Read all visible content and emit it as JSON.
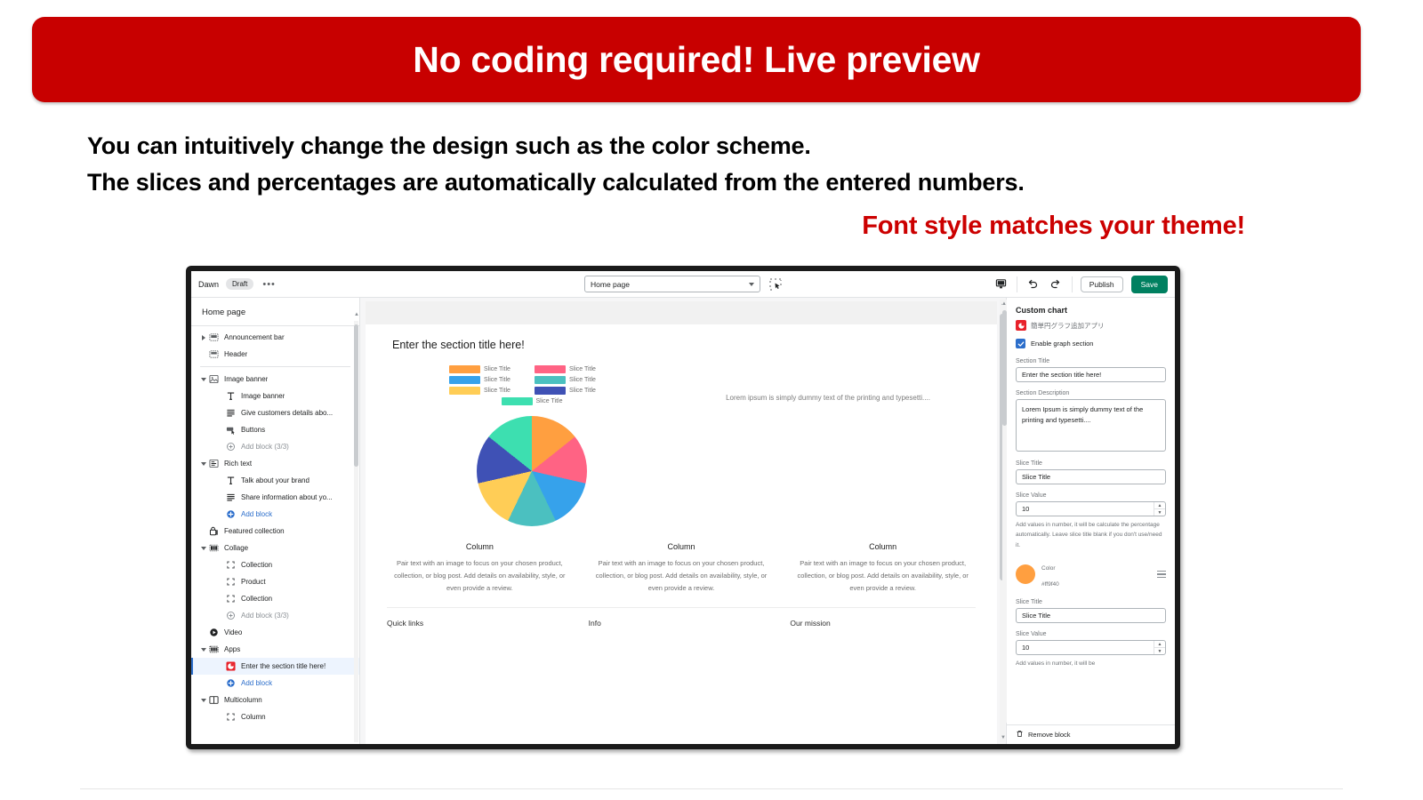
{
  "banner": {
    "text": "No coding required! Live preview",
    "bg": "#c80000",
    "fg": "#ffffff"
  },
  "headlines": {
    "line1": "You can intuitively change the design such as the color scheme.",
    "line2": "The slices and percentages are automatically calculated from the entered numbers.",
    "line3": "Font style matches your theme!",
    "line3_color": "#cc0000"
  },
  "editor": {
    "toolbar": {
      "theme_name": "Dawn",
      "status_badge": "Draft",
      "more_dots": "•••",
      "page_selector_value": "Home page",
      "publish_label": "Publish",
      "save_label": "Save",
      "save_color": "#008060"
    },
    "sidebar": {
      "title": "Home page",
      "items": [
        {
          "label": "Announcement bar",
          "icon": "section-icon",
          "twisty": "right",
          "depth": 0,
          "style": "normal"
        },
        {
          "label": "Header",
          "icon": "header-icon",
          "twisty": "none",
          "depth": 0,
          "style": "normal"
        },
        {
          "label": "Image banner",
          "icon": "image-icon",
          "twisty": "down",
          "depth": 0,
          "style": "normal"
        },
        {
          "label": "Image banner",
          "icon": "text-icon",
          "twisty": "none",
          "depth": 1,
          "style": "normal"
        },
        {
          "label": "Give customers details abo...",
          "icon": "paragraph-icon",
          "twisty": "none",
          "depth": 1,
          "style": "normal"
        },
        {
          "label": "Buttons",
          "icon": "button-icon",
          "twisty": "none",
          "depth": 1,
          "style": "normal"
        },
        {
          "label": "Add block (3/3)",
          "icon": "plus-circle-icon",
          "twisty": "none",
          "depth": 1,
          "style": "muted"
        },
        {
          "label": "Rich text",
          "icon": "richtext-icon",
          "twisty": "down",
          "depth": 0,
          "style": "normal"
        },
        {
          "label": "Talk about your brand",
          "icon": "text-icon",
          "twisty": "none",
          "depth": 1,
          "style": "normal"
        },
        {
          "label": "Share information about yo...",
          "icon": "paragraph-icon",
          "twisty": "none",
          "depth": 1,
          "style": "normal"
        },
        {
          "label": "Add block",
          "icon": "plus-circle-blue-icon",
          "twisty": "none",
          "depth": 1,
          "style": "link"
        },
        {
          "label": "Featured collection",
          "icon": "collection-icon",
          "twisty": "none",
          "depth": 0,
          "style": "normal"
        },
        {
          "label": "Collage",
          "icon": "collage-icon",
          "twisty": "down",
          "depth": 0,
          "style": "normal"
        },
        {
          "label": "Collection",
          "icon": "block-icon",
          "twisty": "none",
          "depth": 1,
          "style": "normal"
        },
        {
          "label": "Product",
          "icon": "block-icon",
          "twisty": "none",
          "depth": 1,
          "style": "normal"
        },
        {
          "label": "Collection",
          "icon": "block-icon",
          "twisty": "none",
          "depth": 1,
          "style": "normal"
        },
        {
          "label": "Add block (3/3)",
          "icon": "plus-circle-icon",
          "twisty": "none",
          "depth": 1,
          "style": "muted"
        },
        {
          "label": "Video",
          "icon": "video-icon",
          "twisty": "none",
          "depth": 0,
          "style": "normal"
        },
        {
          "label": "Apps",
          "icon": "apps-icon",
          "twisty": "down",
          "depth": 0,
          "style": "normal"
        },
        {
          "label": "Enter the section title here!",
          "icon": "app-red-icon",
          "twisty": "none",
          "depth": 1,
          "style": "selected"
        },
        {
          "label": "Add block",
          "icon": "plus-circle-blue-icon",
          "twisty": "none",
          "depth": 1,
          "style": "link"
        },
        {
          "label": "Multicolumn",
          "icon": "multicolumn-icon",
          "twisty": "down",
          "depth": 0,
          "style": "normal"
        },
        {
          "label": "Column",
          "icon": "block-icon",
          "twisty": "none",
          "depth": 1,
          "style": "normal"
        }
      ]
    },
    "preview": {
      "section_title": "Enter the section title here!",
      "lorem": "Lorem ipsum is simply dummy text of the printing and typesetti....",
      "columns": [
        {
          "heading": "Column",
          "text": "Pair text with an image to focus on your chosen product, collection, or blog post. Add details on availability, style, or even provide a review."
        },
        {
          "heading": "Column",
          "text": "Pair text with an image to focus on your chosen product, collection, or blog post. Add details on availability, style, or even provide a review."
        },
        {
          "heading": "Column",
          "text": "Pair text with an image to focus on your chosen product, collection, or blog post. Add details on availability, style, or even provide a review."
        }
      ],
      "footer": [
        "Quick links",
        "Info",
        "Our mission"
      ]
    },
    "settings": {
      "heading": "Custom chart",
      "app_name": "簡単円グラフ追加アプリ",
      "enable_label": "Enable graph section",
      "enable_checked": true,
      "section_title_label": "Section Title",
      "section_title_value": "Enter the section title here!",
      "section_desc_label": "Section Description",
      "section_desc_value": "Lorem Ipsum is simply dummy text of the printing and typesetti....",
      "slice1": {
        "title_label": "Slice Title",
        "title_value": "Slice Title",
        "value_label": "Slice Value",
        "value": "10",
        "help": "Add values in number, it will be calculate the percentage automatically. Leave slice title blank if you don't use/need it.",
        "color_label": "Color",
        "color_hex": "#ff9f40"
      },
      "slice2": {
        "title_label": "Slice Title",
        "title_value": "Slice Title",
        "value_label": "Slice Value",
        "value": "10",
        "help": "Add values in number, it will be"
      },
      "remove_label": "Remove block"
    }
  },
  "chart_data": {
    "type": "pie",
    "title": "Enter the section title here!",
    "categories": [
      "Slice Title",
      "Slice Title",
      "Slice Title",
      "Slice Title",
      "Slice Title",
      "Slice Title",
      "Slice Title"
    ],
    "values": [
      10,
      10,
      10,
      10,
      10,
      10,
      10
    ],
    "percentages": [
      14.29,
      14.29,
      14.29,
      14.29,
      14.29,
      14.29,
      14.29
    ],
    "colors": [
      "#ff9f40",
      "#ff6384",
      "#36a2eb",
      "#4bc0c0",
      "#ffcd56",
      "#3f51b5",
      "#3ddfb0"
    ],
    "legend_position": "top",
    "legend_labels": [
      "Slice Title",
      "Slice Title",
      "Slice Title",
      "Slice Title",
      "Slice Title",
      "Slice Title",
      "Slice Title"
    ],
    "xlabel": "",
    "ylabel": ""
  }
}
